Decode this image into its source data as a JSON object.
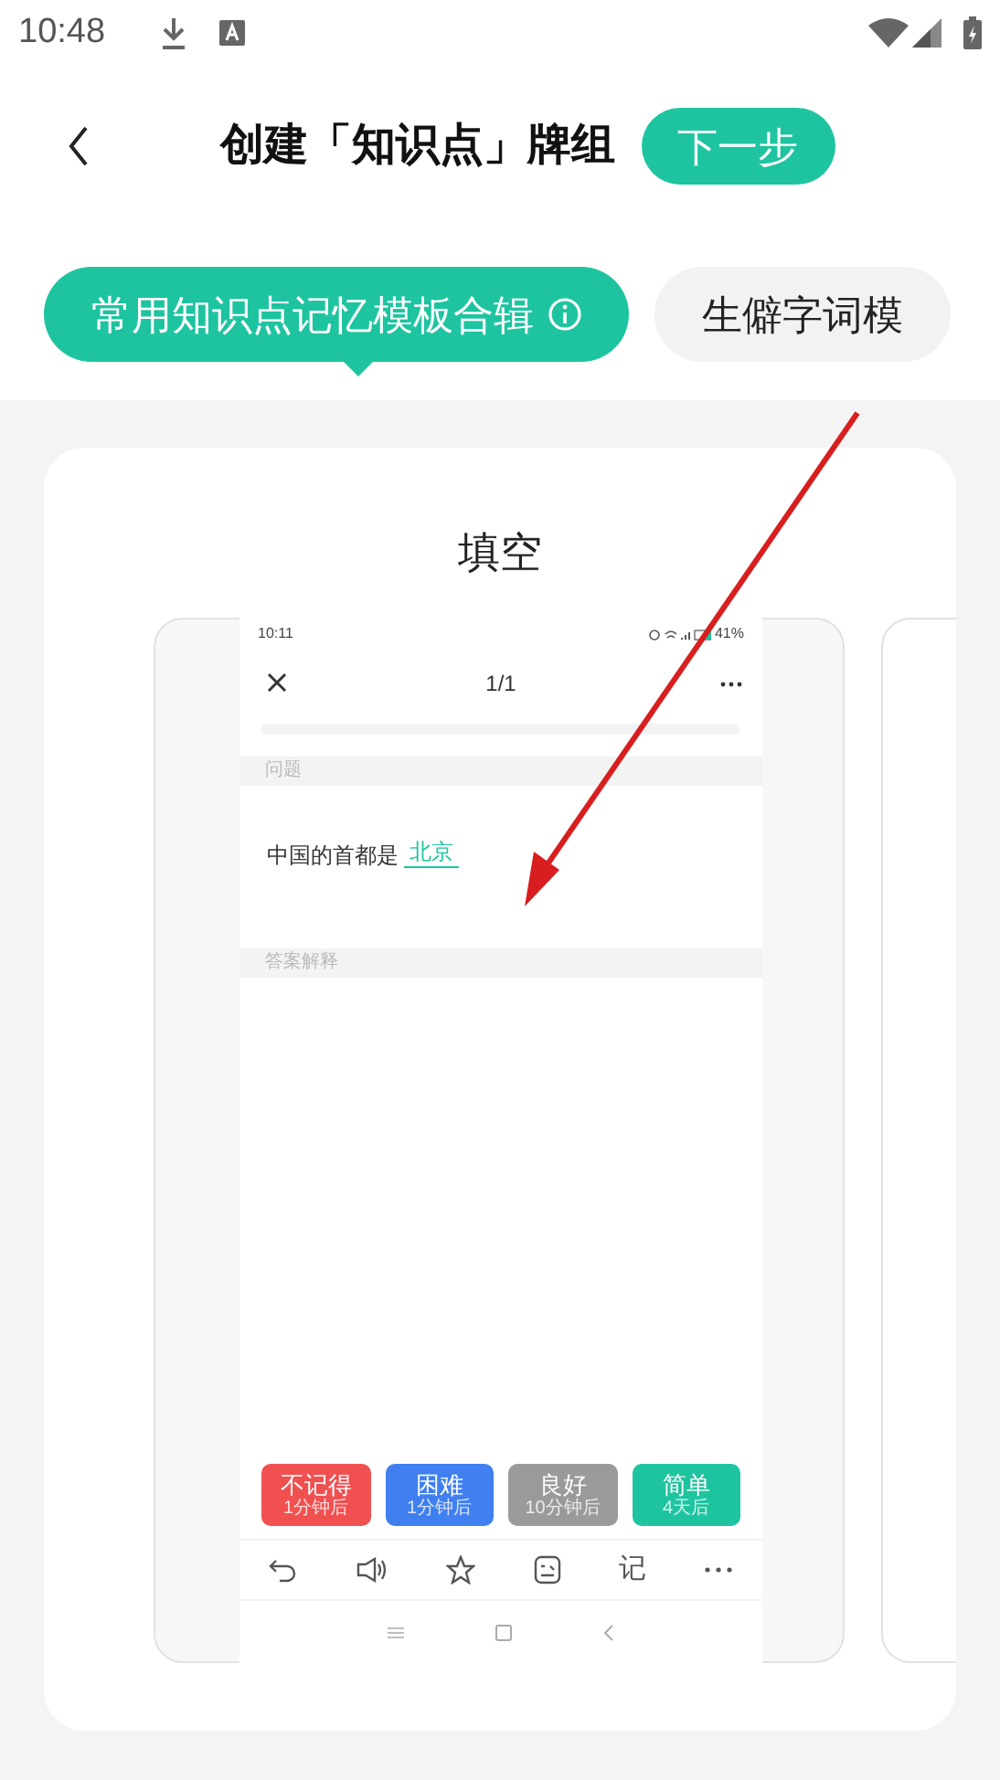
{
  "status_bar": {
    "time": "10:48"
  },
  "header": {
    "title": "创建「知识点」牌组",
    "next_button": "下一步"
  },
  "tabs": [
    {
      "label": "常用知识点记忆模板合辑",
      "selected": true,
      "info": true
    },
    {
      "label": "生僻字词模",
      "selected": false,
      "info": false
    }
  ],
  "template": {
    "title": "填空",
    "preview": {
      "time": "10:11",
      "battery": "41%",
      "counter": "1/1",
      "question_label": "问题",
      "question": "中国的首都是",
      "answer": "北京",
      "explanation_label": "答案解释",
      "grade_buttons": [
        {
          "label": "不记得",
          "interval": "1分钟后",
          "color": "#f05050"
        },
        {
          "label": "困难",
          "interval": "1分钟后",
          "color": "#3f7ff0"
        },
        {
          "label": "良好",
          "interval": "10分钟后",
          "color": "#9a9a9a"
        },
        {
          "label": "简单",
          "interval": "4天后",
          "color": "#1ec4a0"
        }
      ],
      "toolbar": [
        {
          "kind": "undo"
        },
        {
          "kind": "sound"
        },
        {
          "kind": "star"
        },
        {
          "kind": "note"
        },
        {
          "kind": "text",
          "label": "记"
        },
        {
          "kind": "more"
        }
      ]
    }
  }
}
